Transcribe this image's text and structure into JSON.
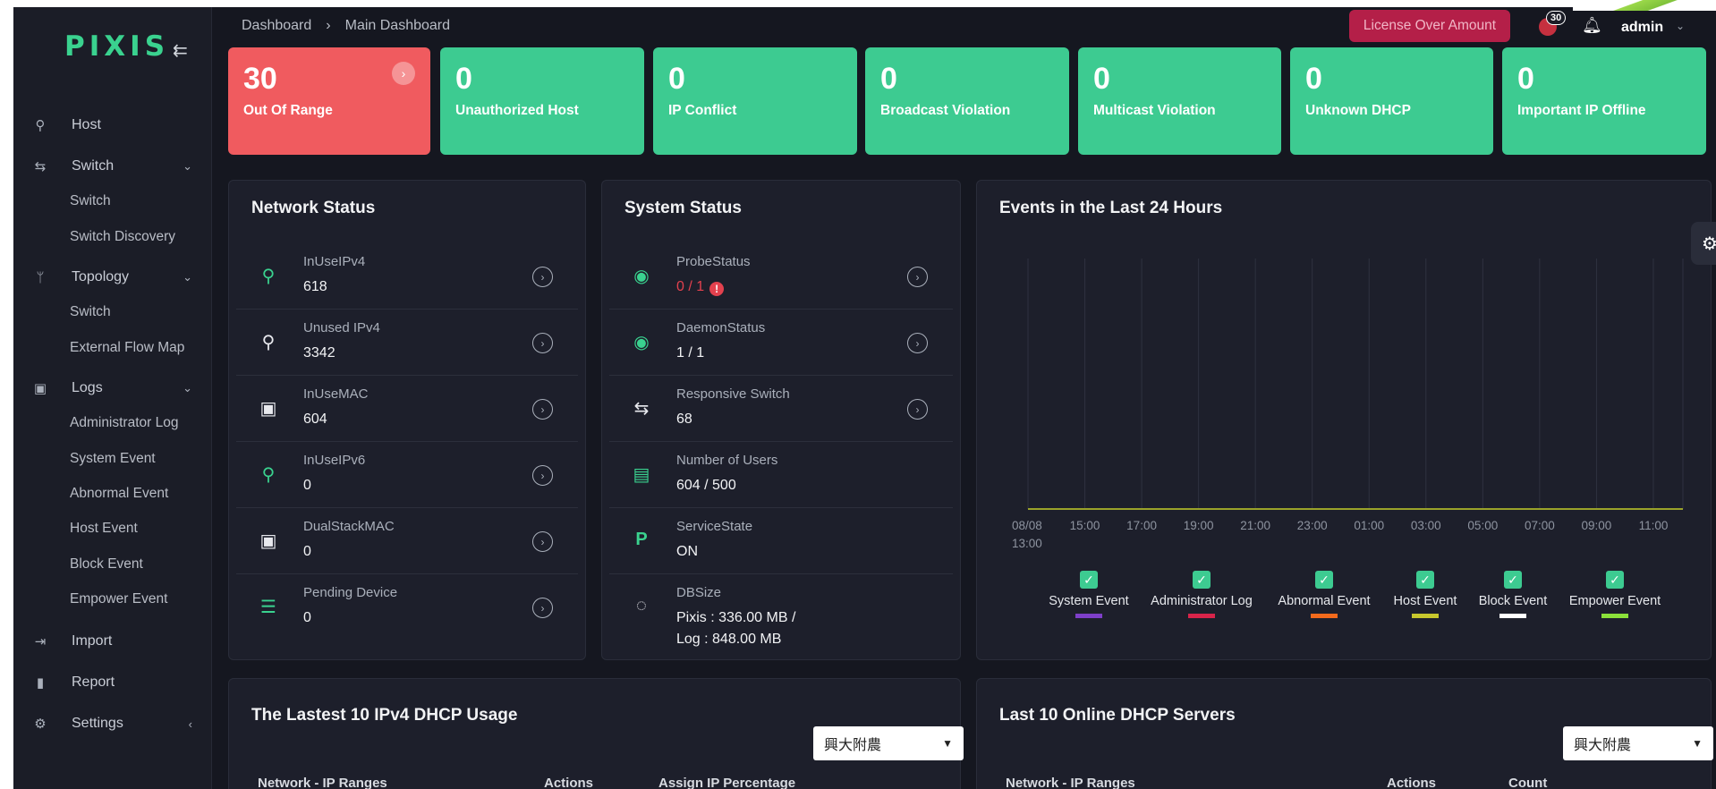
{
  "app": {
    "logo": "PIXIS"
  },
  "sidebar": {
    "items": [
      {
        "label": "Host",
        "icon": "pin-icon"
      },
      {
        "label": "Switch",
        "icon": "switch-icon",
        "expanded": true,
        "children": [
          "Switch",
          "Switch Discovery"
        ]
      },
      {
        "label": "Topology",
        "icon": "topology-icon",
        "expanded": true,
        "children": [
          "Switch",
          "External Flow Map"
        ]
      },
      {
        "label": "Logs",
        "icon": "calendar-icon",
        "expanded": true,
        "children": [
          "Administrator Log",
          "System Event",
          "Abnormal Event",
          "Host Event",
          "Block Event",
          "Empower Event"
        ]
      },
      {
        "label": "Import",
        "icon": "import-icon"
      },
      {
        "label": "Report",
        "icon": "file-icon"
      },
      {
        "label": "Settings",
        "icon": "gear-icon"
      }
    ]
  },
  "header": {
    "breadcrumb": [
      "Dashboard",
      "Main Dashboard"
    ],
    "license_label": "License Over Amount",
    "alarm_count": "30",
    "user": "admin"
  },
  "cards": [
    {
      "value": "30",
      "label": "Out Of Range",
      "color": "#f05b5f"
    },
    {
      "value": "0",
      "label": "Unauthorized Host",
      "color": "#3dcb91"
    },
    {
      "value": "0",
      "label": "IP Conflict",
      "color": "#3dcb91"
    },
    {
      "value": "0",
      "label": "Broadcast Violation",
      "color": "#3dcb91"
    },
    {
      "value": "0",
      "label": "Multicast Violation",
      "color": "#3dcb91"
    },
    {
      "value": "0",
      "label": "Unknown DHCP",
      "color": "#3dcb91"
    },
    {
      "value": "0",
      "label": "Important IP Offline",
      "color": "#3dcb91"
    }
  ],
  "network_status": {
    "title": "Network Status",
    "rows": [
      {
        "name": "InUseIPv4",
        "value": "618",
        "icon": "pin-icon"
      },
      {
        "name": "Unused IPv4",
        "value": "3342",
        "icon": "pin-icon"
      },
      {
        "name": "InUseMAC",
        "value": "604",
        "icon": "monitor-icon"
      },
      {
        "name": "InUseIPv6",
        "value": "0",
        "icon": "pin-icon"
      },
      {
        "name": "DualStackMAC",
        "value": "0",
        "icon": "monitor-icon"
      },
      {
        "name": "Pending Device",
        "value": "0",
        "icon": "checklist-icon"
      }
    ]
  },
  "system_status": {
    "title": "System Status",
    "rows": [
      {
        "name": "ProbeStatus",
        "value": "0 / 1",
        "icon": "broadcast-icon"
      },
      {
        "name": "DaemonStatus",
        "value": "1 / 1",
        "icon": "broadcast-icon"
      },
      {
        "name": "Responsive Switch",
        "value": "68",
        "icon": "switch-icon"
      },
      {
        "name": "Number of Users",
        "value": "604 / 500",
        "icon": "server-icon"
      },
      {
        "name": "ServiceState",
        "value": "ON",
        "icon": "p-logo-icon"
      },
      {
        "name": "DBSize",
        "value": "Pixis : 336.00 MB /",
        "value2": "Log : 848.00 MB",
        "icon": "donut-icon"
      }
    ]
  },
  "events_chart": {
    "title": "Events in the Last 24 Hours"
  },
  "chart_data": {
    "type": "line",
    "x": [
      "08/08 13:00",
      "15:00",
      "17:00",
      "19:00",
      "21:00",
      "23:00",
      "01:00",
      "03:00",
      "05:00",
      "07:00",
      "09:00",
      "11:00"
    ],
    "series": [
      {
        "name": "System Event",
        "values": [
          0,
          0,
          0,
          0,
          0,
          0,
          0,
          0,
          0,
          0,
          0,
          0
        ],
        "color": "#7e3fc9"
      },
      {
        "name": "Administrator Log",
        "values": [
          0,
          0,
          0,
          0,
          0,
          0,
          0,
          0,
          0,
          0,
          0,
          0
        ],
        "color": "#d8244a"
      },
      {
        "name": "Abnormal Event",
        "values": [
          0,
          0,
          0,
          0,
          0,
          0,
          0,
          0,
          0,
          0,
          0,
          0
        ],
        "color": "#f36a1c"
      },
      {
        "name": "Host Event",
        "values": [
          0,
          0,
          0,
          0,
          0,
          0,
          0,
          0,
          0,
          0,
          0,
          0
        ],
        "color": "#c7c72d"
      },
      {
        "name": "Block Event",
        "values": [
          0,
          0,
          0,
          0,
          0,
          0,
          0,
          0,
          0,
          0,
          0,
          0
        ],
        "color": "#ffffff"
      },
      {
        "name": "Empower Event",
        "values": [
          0,
          0,
          0,
          0,
          0,
          0,
          0,
          0,
          0,
          0,
          0,
          0
        ],
        "color": "#8be03a"
      }
    ],
    "grid": true,
    "legend": "bottom"
  },
  "dhcp_usage": {
    "title": "The Lastest 10 IPv4 DHCP Usage",
    "select": "興大附農",
    "columns": [
      "Network - IP Ranges",
      "Actions",
      "Assign IP Percentage"
    ]
  },
  "dhcp_servers": {
    "title": "Last 10 Online DHCP Servers",
    "select": "興大附農",
    "columns": [
      "Network - IP Ranges",
      "Actions",
      "Count"
    ]
  }
}
